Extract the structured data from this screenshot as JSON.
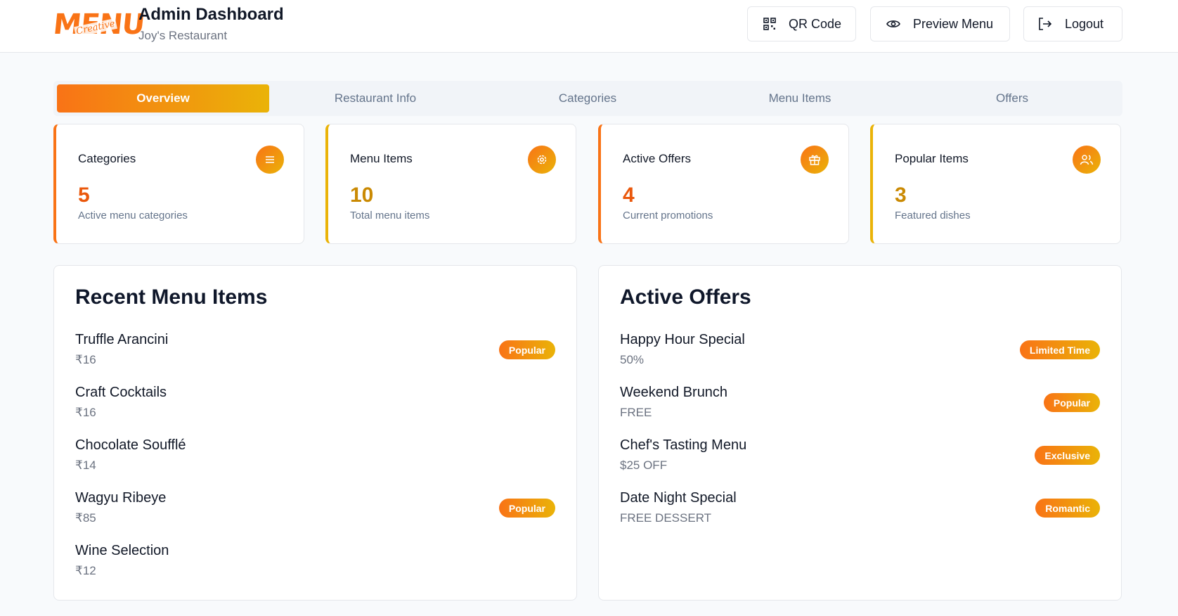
{
  "header": {
    "logo_text": "MENU",
    "logo_script": "Creative",
    "title": "Admin Dashboard",
    "subtitle": "Joy's Restaurant",
    "buttons": {
      "qr": "QR Code",
      "preview": "Preview Menu",
      "logout": "Logout"
    }
  },
  "tabs": [
    {
      "label": "Overview",
      "active": true
    },
    {
      "label": "Restaurant Info",
      "active": false
    },
    {
      "label": "Categories",
      "active": false
    },
    {
      "label": "Menu Items",
      "active": false
    },
    {
      "label": "Offers",
      "active": false
    }
  ],
  "stats": [
    {
      "label": "Categories",
      "value": "5",
      "desc": "Active menu categories",
      "icon": "list-icon"
    },
    {
      "label": "Menu Items",
      "value": "10",
      "desc": "Total menu items",
      "icon": "gear-icon"
    },
    {
      "label": "Active Offers",
      "value": "4",
      "desc": "Current promotions",
      "icon": "gift-icon"
    },
    {
      "label": "Popular Items",
      "value": "3",
      "desc": "Featured dishes",
      "icon": "users-icon"
    }
  ],
  "recent_items": {
    "title": "Recent Menu Items",
    "items": [
      {
        "name": "Truffle Arancini",
        "price": "₹16",
        "badge": "Popular"
      },
      {
        "name": "Craft Cocktails",
        "price": "₹16",
        "badge": ""
      },
      {
        "name": "Chocolate Soufflé",
        "price": "₹14",
        "badge": ""
      },
      {
        "name": "Wagyu Ribeye",
        "price": "₹85",
        "badge": "Popular"
      },
      {
        "name": "Wine Selection",
        "price": "₹12",
        "badge": ""
      }
    ]
  },
  "active_offers": {
    "title": "Active Offers",
    "items": [
      {
        "name": "Happy Hour Special",
        "value": "50%",
        "badge": "Limited Time"
      },
      {
        "name": "Weekend Brunch",
        "value": "FREE",
        "badge": "Popular"
      },
      {
        "name": "Chef's Tasting Menu",
        "value": "$25 OFF",
        "badge": "Exclusive"
      },
      {
        "name": "Date Night Special",
        "value": "FREE DESSERT",
        "badge": "Romantic"
      }
    ]
  },
  "colors": {
    "accent_orange": "#f97316",
    "accent_yellow": "#eab308"
  }
}
